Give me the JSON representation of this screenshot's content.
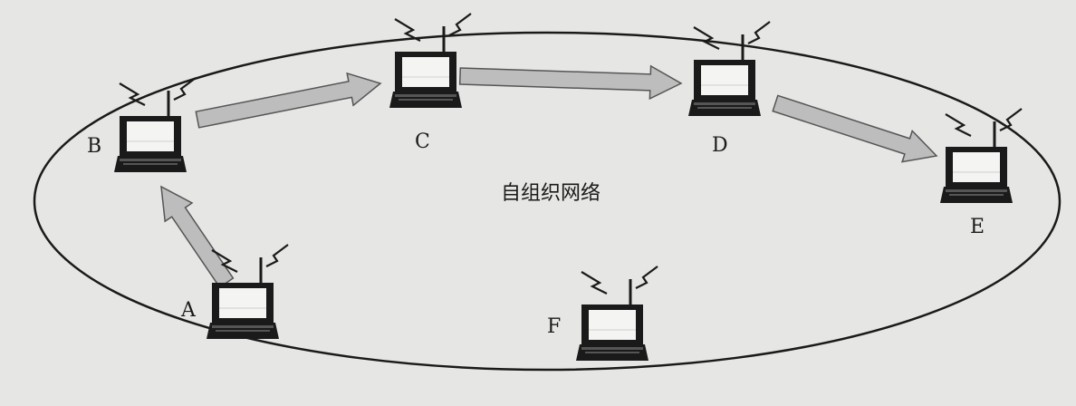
{
  "diagram": {
    "network_label": "自组织网络",
    "nodes": [
      {
        "id": "A",
        "label": "A"
      },
      {
        "id": "B",
        "label": "B"
      },
      {
        "id": "C",
        "label": "C"
      },
      {
        "id": "D",
        "label": "D"
      },
      {
        "id": "E",
        "label": "E"
      },
      {
        "id": "F",
        "label": "F"
      }
    ],
    "routes": [
      {
        "from": "A",
        "to": "B"
      },
      {
        "from": "B",
        "to": "C"
      },
      {
        "from": "C",
        "to": "D"
      },
      {
        "from": "D",
        "to": "E"
      }
    ],
    "colors": {
      "background": "#e6e6e4",
      "arrow_fill": "#bdbdbd",
      "outline": "#1a1a1a",
      "screen": "#f4f4f2"
    }
  }
}
